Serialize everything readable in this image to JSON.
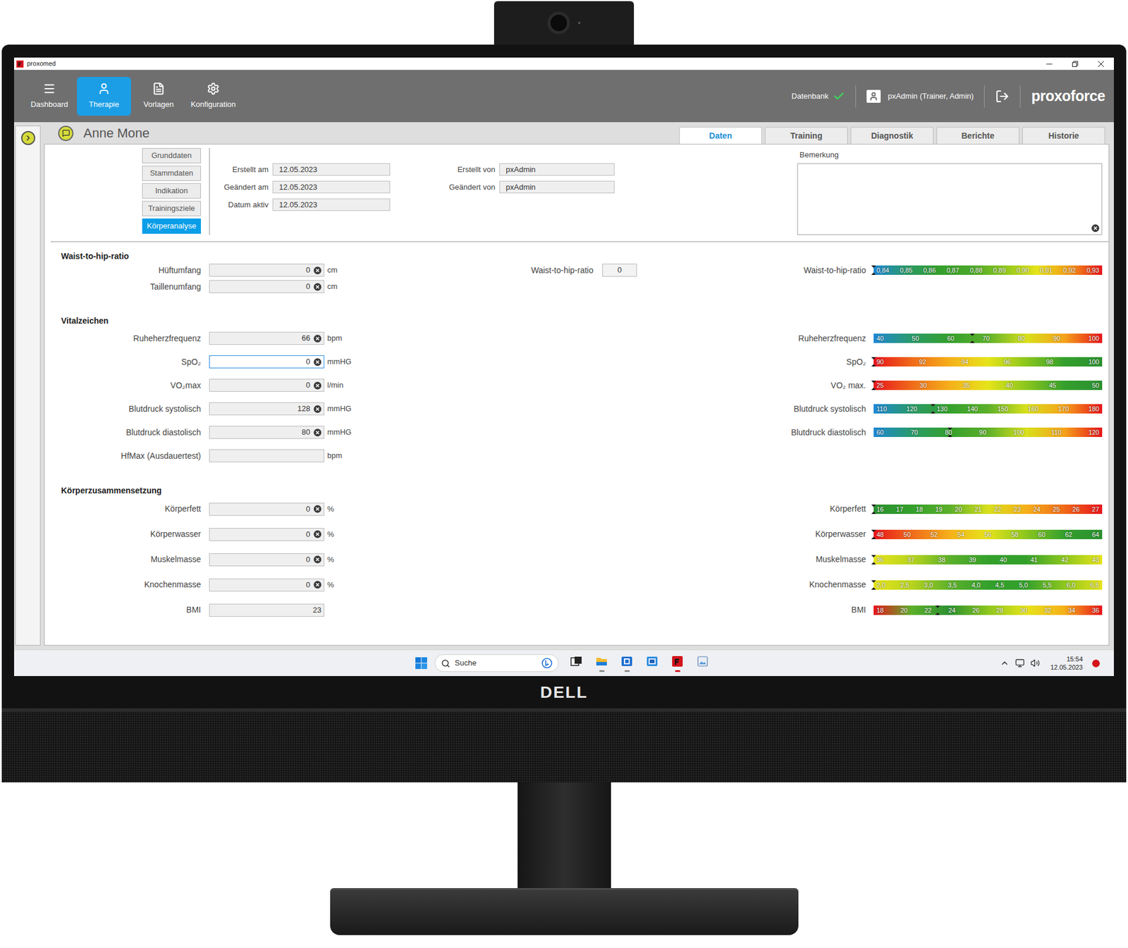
{
  "window": {
    "title": "proxomed"
  },
  "toolbar": {
    "nav": [
      {
        "label": "Dashboard",
        "selected": false
      },
      {
        "label": "Therapie",
        "selected": true
      },
      {
        "label": "Vorlagen",
        "selected": false
      },
      {
        "label": "Konfiguration",
        "selected": false
      }
    ],
    "database": {
      "label": "Datenbank",
      "connected": true
    },
    "user": "pxAdmin (Trainer, Admin)",
    "logo": "proxoforce"
  },
  "patient": {
    "name": "Anne Mone"
  },
  "tabs": [
    {
      "label": "Daten",
      "selected": true
    },
    {
      "label": "Training",
      "selected": false
    },
    {
      "label": "Diagnostik",
      "selected": false
    },
    {
      "label": "Berichte",
      "selected": false
    },
    {
      "label": "Historie",
      "selected": false
    }
  ],
  "subnav": [
    {
      "label": "Grunddaten",
      "selected": false
    },
    {
      "label": "Stammdaten",
      "selected": false
    },
    {
      "label": "Indikation",
      "selected": false
    },
    {
      "label": "Trainingsziele",
      "selected": false
    },
    {
      "label": "Körperanalyse",
      "selected": true
    }
  ],
  "meta": {
    "left": [
      {
        "label": "Erstellt am",
        "value": "12.05.2023"
      },
      {
        "label": "Geändert am",
        "value": "12.05.2023"
      },
      {
        "label": "Datum aktiv",
        "value": "12.05.2023"
      }
    ],
    "right": [
      {
        "label": "Erstellt von",
        "value": "pxAdmin"
      },
      {
        "label": "Geändert von",
        "value": "pxAdmin"
      }
    ]
  },
  "remark": {
    "label": "Bemerkung",
    "value": ""
  },
  "sections": [
    {
      "title": "Waist-to-hip-ratio",
      "rows": [
        {
          "field": {
            "label": "Hüftumfang",
            "value": "0",
            "unit": "cm",
            "clearable": true,
            "focused": false
          },
          "result": {
            "label": "Waist-to-hip-ratio",
            "value": "0"
          },
          "scale": {
            "label": "Waist-to-hip-ratio",
            "ticks": [
              "0,84",
              "0,85",
              "0,86",
              "0,87",
              "0,88",
              "0,89",
              "0,90",
              "0,91",
              "0,92",
              "0,93"
            ],
            "level": 0,
            "gradient": [
              "#1e88d6",
              "#2a9a6a",
              "#34a02c",
              "#4aa82a",
              "#8cc61e",
              "#e6e41a",
              "#f29a18",
              "#e8141c"
            ]
          }
        },
        {
          "field": {
            "label": "Taillenumfang",
            "value": "0",
            "unit": "cm",
            "clearable": true,
            "focused": false
          }
        }
      ]
    },
    {
      "title": "Vitalzeichen",
      "rows": [
        {
          "field": {
            "label": "Ruheherzfrequenz",
            "value": "66",
            "unit": "bpm",
            "clearable": true,
            "focused": false
          },
          "scale": {
            "label": "Ruheherzfrequenz",
            "ticks": [
              "40",
              "50",
              "60",
              "70",
              "80",
              "90",
              "100"
            ],
            "level": 0.433,
            "gradient": [
              "#1e88d6",
              "#2a9a6a",
              "#34a02c",
              "#5cb02a",
              "#d8e01c",
              "#f5a31a",
              "#e8141c"
            ]
          }
        },
        {
          "field": {
            "label": "SpO₂",
            "value": "0",
            "unit": "mmHG",
            "clearable": true,
            "focused": true
          },
          "scale": {
            "label": "SpO₂",
            "ticks": [
              "90",
              "92",
              "94",
              "96",
              "98",
              "100"
            ],
            "level": 0,
            "gradient": [
              "#e8141c",
              "#f06a1a",
              "#f5b01a",
              "#e6e41a",
              "#8cc61e",
              "#34a02c",
              "#2b9030"
            ]
          }
        },
        {
          "field": {
            "label": "VO₂max",
            "value": "0",
            "unit": "l/min",
            "clearable": true,
            "focused": false
          },
          "scale": {
            "label": "VO₂ max.",
            "ticks": [
              "25",
              "30",
              "35",
              "40",
              "45",
              "50"
            ],
            "level": 0,
            "gradient": [
              "#e8141c",
              "#f06a1a",
              "#f5b01a",
              "#e6e41a",
              "#8cc61e",
              "#34a02c",
              "#2b9030"
            ]
          }
        },
        {
          "field": {
            "label": "Blutdruck systolisch",
            "value": "128",
            "unit": "mmHG",
            "clearable": true,
            "focused": false
          },
          "scale": {
            "label": "Blutdruck systolisch",
            "ticks": [
              "110",
              "120",
              "130",
              "140",
              "150",
              "160",
              "170",
              "180"
            ],
            "level": 0.26,
            "gradient": [
              "#1e88d6",
              "#2a9a6a",
              "#34a02c",
              "#5cb02a",
              "#d8e01c",
              "#f5a31a",
              "#e8141c"
            ]
          }
        },
        {
          "field": {
            "label": "Blutdruck diastolisch",
            "value": "80",
            "unit": "mmHG",
            "clearable": true,
            "focused": false
          },
          "scale": {
            "label": "Blutdruck diastolisch",
            "ticks": [
              "60",
              "70",
              "80",
              "90",
              "100",
              "110",
              "120"
            ],
            "level": 0.333,
            "gradient": [
              "#1e88d6",
              "#2a9a6a",
              "#34a02c",
              "#5cb02a",
              "#d8e01c",
              "#f5a31a",
              "#e8141c"
            ]
          }
        },
        {
          "field": {
            "label": "HfMax (Ausdauertest)",
            "value": "",
            "unit": "bpm",
            "clearable": false,
            "focused": false
          }
        }
      ]
    },
    {
      "title": "Körperzusammensetzung",
      "rows": [
        {
          "field": {
            "label": "Körperfett",
            "value": "0",
            "unit": "%",
            "clearable": true,
            "focused": false
          },
          "scale": {
            "label": "Körperfett",
            "ticks": [
              "16",
              "17",
              "18",
              "19",
              "20",
              "21",
              "22",
              "23",
              "24",
              "25",
              "26",
              "27"
            ],
            "level": 0,
            "gradient": [
              "#2b9030",
              "#34a02c",
              "#5cb02a",
              "#d8e01c",
              "#f5b01a",
              "#f06a1a",
              "#e8141c"
            ]
          }
        },
        {
          "field": {
            "label": "Körperwasser",
            "value": "0",
            "unit": "%",
            "clearable": true,
            "focused": false
          },
          "scale": {
            "label": "Körperwasser",
            "ticks": [
              "48",
              "50",
              "52",
              "54",
              "56",
              "58",
              "60",
              "62",
              "64"
            ],
            "level": 0,
            "gradient": [
              "#e8141c",
              "#f06a1a",
              "#f5b01a",
              "#e6e41a",
              "#8cc61e",
              "#34a02c",
              "#2b9030"
            ]
          }
        },
        {
          "field": {
            "label": "Muskelmasse",
            "value": "0",
            "unit": "%",
            "clearable": true,
            "focused": false
          },
          "scale": {
            "label": "Muskelmasse",
            "ticks": [
              "36",
              "37",
              "38",
              "39",
              "40",
              "41",
              "42",
              "43"
            ],
            "level": 0,
            "gradient": [
              "#e6e41a",
              "#b8d41e",
              "#5cb02a",
              "#34a02c",
              "#34a02c",
              "#8cc61e",
              "#e6e41a"
            ]
          }
        },
        {
          "field": {
            "label": "Knochenmasse",
            "value": "0",
            "unit": "%",
            "clearable": true,
            "focused": false
          },
          "scale": {
            "label": "Knochenmasse",
            "ticks": [
              "2,0",
              "2,5",
              "3,0",
              "3,5",
              "4,0",
              "4,5",
              "5,0",
              "5,5",
              "6,0",
              "6,5"
            ],
            "level": 0,
            "gradient": [
              "#e6e41a",
              "#b8d41e",
              "#5cb02a",
              "#34a02c",
              "#34a02c",
              "#8cc61e",
              "#e6e41a"
            ]
          }
        },
        {
          "field": {
            "label": "BMI",
            "value": "23",
            "clearable": false,
            "focused": false
          },
          "scale": {
            "label": "BMI",
            "ticks": [
              "18",
              "20",
              "22",
              "24",
              "26",
              "28",
              "30",
              "32",
              "34",
              "36"
            ],
            "level": 0.28,
            "gradient": [
              "#e8141c",
              "#5cb02a",
              "#2b9030",
              "#8cc61e",
              "#e6e41a",
              "#f5b01a",
              "#e8141c"
            ]
          }
        }
      ]
    }
  ],
  "taskbar": {
    "search": {
      "placeholder": "Suche"
    },
    "apps": [
      {
        "kind": "taskview",
        "active": false
      },
      {
        "kind": "explorer",
        "active": true
      },
      {
        "kind": "app",
        "active": true
      },
      {
        "kind": "app2",
        "active": false
      },
      {
        "kind": "proxomed",
        "active": true
      },
      {
        "kind": "viewer",
        "active": false
      }
    ],
    "time": "15:54",
    "date": "12.05.2023",
    "notification": {
      "unread": true
    }
  },
  "monitor": {
    "brand": "DELL"
  }
}
